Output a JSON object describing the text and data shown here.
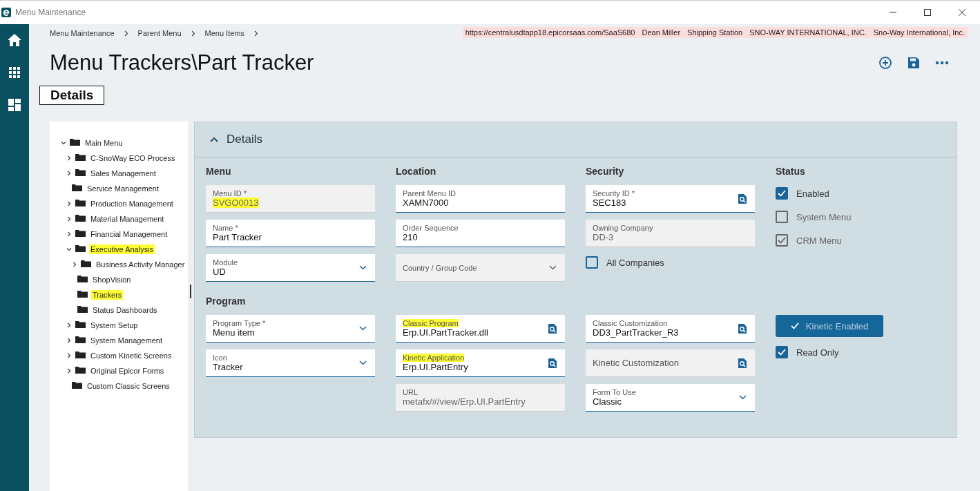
{
  "window": {
    "title": "Menu Maintenance"
  },
  "breadcrumbs": [
    "Menu Maintenance",
    "Parent Menu",
    "Menu Items"
  ],
  "session_info": [
    "https://centralusdtapp18.epicorsaas.com/SaaS680",
    "Dean Miller",
    "Shipping Station",
    "SNO-WAY INTERNATIONAL, INC.",
    "Sno-Way International, Inc."
  ],
  "page_title": "Menu Trackers\\Part Tracker",
  "tabs": [
    {
      "label": "Details",
      "selected": true
    }
  ],
  "tree": [
    {
      "label": "Main Menu",
      "expanded": true,
      "highlighted": false,
      "children": [
        {
          "label": "C-SnoWay ECO Process",
          "expanded": false,
          "highlighted": false
        },
        {
          "label": "Sales Management",
          "expanded": false,
          "highlighted": false
        },
        {
          "label": "Service Management",
          "highlighted": false
        },
        {
          "label": "Production Management",
          "expanded": false,
          "highlighted": false
        },
        {
          "label": "Material Management",
          "expanded": false,
          "highlighted": false
        },
        {
          "label": "Financial Management",
          "expanded": false,
          "highlighted": false
        },
        {
          "label": "Executive Analysis",
          "expanded": true,
          "highlighted": true,
          "children": [
            {
              "label": "Business Activity Manager",
              "expanded": false,
              "highlighted": false
            },
            {
              "label": "ShopVision",
              "highlighted": false
            },
            {
              "label": "Trackers",
              "highlighted": true
            },
            {
              "label": "Status Dashboards",
              "highlighted": false
            }
          ]
        },
        {
          "label": "System Setup",
          "expanded": false,
          "highlighted": false
        },
        {
          "label": "System Management",
          "expanded": false,
          "highlighted": false
        },
        {
          "label": "Custom Kinetic Screens",
          "expanded": false,
          "highlighted": false
        },
        {
          "label": "Original Epicor Forms",
          "expanded": false,
          "highlighted": false
        },
        {
          "label": "Custom Classic Screens",
          "highlighted": false
        }
      ]
    }
  ],
  "panel": {
    "title": "Details",
    "expanded": true,
    "sections": [
      {
        "columns": [
          {
            "heading": "Menu",
            "items": [
              {
                "kind": "text",
                "label": "Menu ID *",
                "value": "SVGO0013",
                "disabled": true,
                "label_highlighted": false,
                "value_highlighted": true
              },
              {
                "kind": "text",
                "label": "Name *",
                "value": "Part Tracker",
                "disabled": false,
                "label_highlighted": false,
                "value_highlighted": false
              },
              {
                "kind": "select",
                "label": "Module",
                "value": "UD",
                "disabled": false,
                "label_highlighted": false,
                "value_highlighted": false
              }
            ]
          },
          {
            "heading": "Location",
            "items": [
              {
                "kind": "text",
                "label": "Parent Menu ID",
                "value": "XAMN7000",
                "disabled": false,
                "label_highlighted": false,
                "value_highlighted": false
              },
              {
                "kind": "text",
                "label": "Order Sequence",
                "value": "210",
                "disabled": false,
                "label_highlighted": false,
                "value_highlighted": false
              },
              {
                "kind": "select",
                "label": "Country / Group Code",
                "disabled": true,
                "label_highlighted": false
              }
            ]
          },
          {
            "heading": "Security",
            "items": [
              {
                "kind": "lookup",
                "label": "Security ID *",
                "value": "SEC183",
                "disabled": false,
                "label_highlighted": false,
                "value_highlighted": false
              },
              {
                "kind": "text",
                "label": "Owning Company",
                "value": "DD-3",
                "disabled": true,
                "label_highlighted": false,
                "value_highlighted": false
              },
              {
                "kind": "checkbox",
                "label": "All Companies",
                "checked": false,
                "disabled": false
              }
            ]
          },
          {
            "heading": "Status",
            "items": [
              {
                "kind": "checkbox",
                "label": "Enabled",
                "checked": true,
                "disabled": false
              },
              {
                "kind": "checkbox",
                "label": "System Menu",
                "checked": false,
                "disabled": true
              },
              {
                "kind": "checkbox",
                "label": "CRM Menu",
                "checked": true,
                "disabled": true
              }
            ]
          }
        ]
      },
      {
        "columns": [
          {
            "heading": "Program",
            "items": [
              {
                "kind": "select",
                "label": "Program Type *",
                "value": "Menu item",
                "disabled": false,
                "label_highlighted": false,
                "value_highlighted": false
              },
              {
                "kind": "select",
                "label": "Icon",
                "value": "Tracker",
                "disabled": false,
                "label_highlighted": false,
                "value_highlighted": false
              }
            ]
          },
          {
            "items": [
              {
                "kind": "lookup",
                "label": "Classic Program",
                "value": "Erp.UI.PartTracker.dll",
                "disabled": false,
                "label_highlighted": true,
                "value_highlighted": false
              },
              {
                "kind": "lookup",
                "label": "Kinetic Application",
                "value": "Erp.UI.PartEntry",
                "disabled": false,
                "label_highlighted": true,
                "value_highlighted": false
              },
              {
                "kind": "text",
                "label": "URL",
                "value": "metafx/#/view/Erp.UI.PartEntry",
                "disabled": true,
                "label_highlighted": false,
                "value_highlighted": false
              }
            ]
          },
          {
            "items": [
              {
                "kind": "lookup",
                "label": "Classic Customization",
                "value": "DD3_PartTracker_R3",
                "disabled": false,
                "label_highlighted": false,
                "value_highlighted": false
              },
              {
                "kind": "lookup",
                "placeholder": "Kinetic Customization",
                "disabled": true,
                "label_highlighted": false
              },
              {
                "kind": "select",
                "label": "Form To Use",
                "value": "Classic",
                "disabled": false,
                "label_highlighted": false,
                "value_highlighted": false
              }
            ]
          },
          {
            "items": [
              {
                "kind": "toggle",
                "label": "Kinetic Enabled",
                "on": true
              },
              {
                "kind": "checkbox",
                "label": "Read Only",
                "checked": true,
                "disabled": false
              }
            ]
          }
        ]
      }
    ]
  }
}
